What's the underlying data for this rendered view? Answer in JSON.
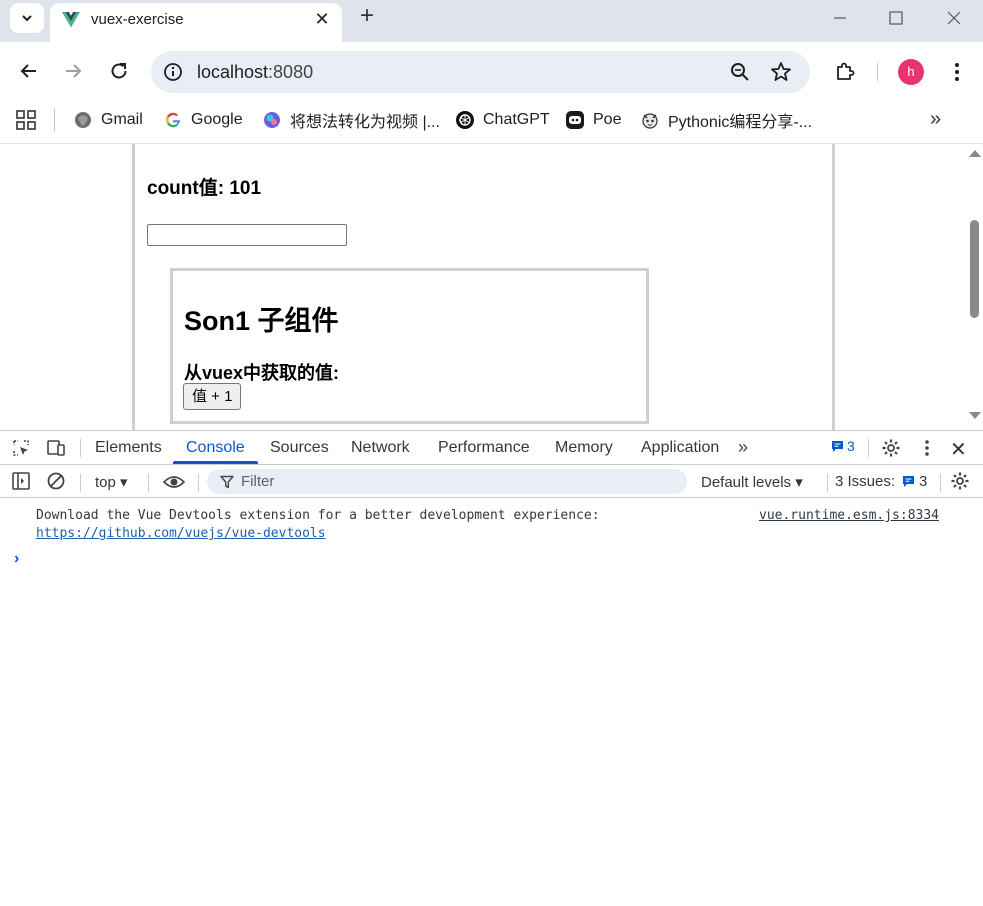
{
  "tab": {
    "title": "vuex-exercise"
  },
  "omnibox": {
    "host": "localhost",
    "port": ":8080"
  },
  "profile": {
    "initial": "h",
    "color": "#e8336f"
  },
  "bookmarks": [
    {
      "label": "Gmail",
      "icon": "gmail-icon"
    },
    {
      "label": "Google",
      "icon": "google-icon"
    },
    {
      "label": "将想法转化为视频 |...",
      "icon": "video-tool-icon"
    },
    {
      "label": "ChatGPT",
      "icon": "chatgpt-icon"
    },
    {
      "label": "Poe",
      "icon": "poe-icon"
    },
    {
      "label": "Pythonic编程分享-...",
      "icon": "pythonic-icon"
    }
  ],
  "page": {
    "count_label": "count值: 101",
    "input_value": "",
    "son1_title": "Son1 子组件",
    "son1_label": "从vuex中获取的值:",
    "son1_button": "值 + 1"
  },
  "devtools": {
    "tabs": [
      "Elements",
      "Console",
      "Sources",
      "Network",
      "Performance",
      "Memory",
      "Application"
    ],
    "active_tab": "Console",
    "issues_badge": "3",
    "context": "top",
    "filter_placeholder": "Filter",
    "levels": "Default levels",
    "issues_text": "3 Issues:",
    "issues_count": "3",
    "accent": "#0b57d0"
  },
  "console": {
    "message": "Download the Vue Devtools extension for a better development experience:",
    "link": "https://github.com/vuejs/vue-devtools",
    "source": "vue.runtime.esm.js:8334"
  }
}
